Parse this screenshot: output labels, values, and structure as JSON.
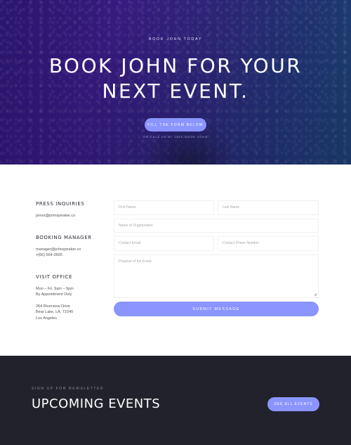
{
  "hero": {
    "eyebrow": "BOOK JOHN TODAY",
    "title_line1": "BOOK JOHN FOR YOUR",
    "title_line2": "NEXT EVENT.",
    "cta_label": "FILL THE FORM BELOW",
    "secondary_text": "OR CALL US AT 1800-BOOK-JOHN"
  },
  "contact": {
    "press": {
      "heading": "PRESS INQUIRIES",
      "email": "press@johnspeaker.co"
    },
    "booking": {
      "heading": "BOOKING MANAGER",
      "email": "manager@johnspeaker.co",
      "phone": "+(66) 664-3605"
    },
    "office": {
      "heading": "VISIT OFFICE",
      "hours1": "Mon – Fri, 9am – 5pm",
      "hours2": "By Appointment Only",
      "address1": "264 Riverview Drive",
      "address2": "Bear Lake, LA, 71040",
      "address3": "Los Angeles"
    }
  },
  "form": {
    "first_name": "First Name",
    "last_name": "Last Name",
    "organization": "Name of Organization",
    "email": "Contact Email",
    "phone": "Contact Phone Number",
    "purpose": "Purpose of the Event",
    "submit_label": "SUBMIT MESSAGE"
  },
  "events": {
    "eyebrow": "SIGN UP FOR NEWSLETTER",
    "title": "UPCOMING EVENTS",
    "see_all_label": "SEE ALL EVENTS"
  },
  "colors": {
    "accent": "#8a95ff",
    "footer_bg": "#22222c",
    "hero_start": "#2a1870",
    "hero_end": "#16506e"
  }
}
